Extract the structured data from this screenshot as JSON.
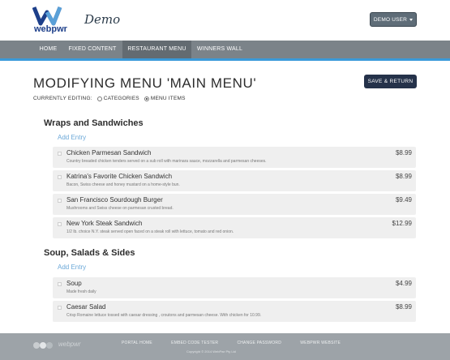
{
  "header": {
    "logo_text": "webpwr",
    "logo_subtext": "WEB CONTROL",
    "app_title": "Demo",
    "user_button": "DEMO USER"
  },
  "nav": [
    {
      "label": "HOME",
      "active": false
    },
    {
      "label": "FIXED CONTENT",
      "active": false
    },
    {
      "label": "RESTAURANT MENU",
      "active": true
    },
    {
      "label": "WINNERS WALL",
      "active": false
    }
  ],
  "page": {
    "title": "MODIFYING MENU 'MAIN MENU'",
    "save_button": "SAVE & RETURN",
    "editing_label": "CURRENTLY EDITING:",
    "options": [
      {
        "label": "CATEGORIES",
        "selected": false
      },
      {
        "label": "MENU ITEMS",
        "selected": true
      }
    ]
  },
  "sections": [
    {
      "title": "Wraps and Sandwiches",
      "add_label": "Add Entry",
      "items": [
        {
          "name": "Chicken Parmesan Sandwich",
          "description": "Country breaded chicken tenders served on a sub roll with marinara sauce, mozzarella and parmesan cheeses.",
          "price": "$8.99"
        },
        {
          "name": "Katrina's Favorite Chicken Sandwich",
          "description": "Bacon, Swiss cheese and honey mustard on a home-style bun.",
          "price": "$8.99"
        },
        {
          "name": "San Francisco Sourdough Burger",
          "description": "Mushrooms and Swiss cheese on parmesan crusted bread.",
          "price": "$9.49"
        },
        {
          "name": "New York Steak Sandwich",
          "description": "1/2 lb. choice N.Y. steak served open faced on a steak roll with lettuce, tomato and red onion.",
          "price": "$12.99"
        }
      ]
    },
    {
      "title": "Soup, Salads & Sides",
      "add_label": "Add Entry",
      "items": [
        {
          "name": "Soup",
          "description": "Made fresh daily",
          "price": "$4.99"
        },
        {
          "name": "Caesar Salad",
          "description": "Crisp Romaine lettuce tossed with caesar dressing , croutons and parmesan cheese. With chicken for 10.99.",
          "price": "$8.99"
        }
      ]
    }
  ],
  "footer": {
    "logo_text": "webpwr",
    "links": [
      "PORTAL HOME",
      "EMBED CODE TESTER",
      "CHANGE PASSWORD",
      "WEBPWR WEBSITE"
    ],
    "copyright": "Copyright © 2014 WebPwr Pty Ltd"
  },
  "colors": {
    "nav_bg": "#7b8389",
    "nav_accent": "#3a9ad9",
    "primary_button": "#25324a",
    "link": "#6ba8d8"
  }
}
